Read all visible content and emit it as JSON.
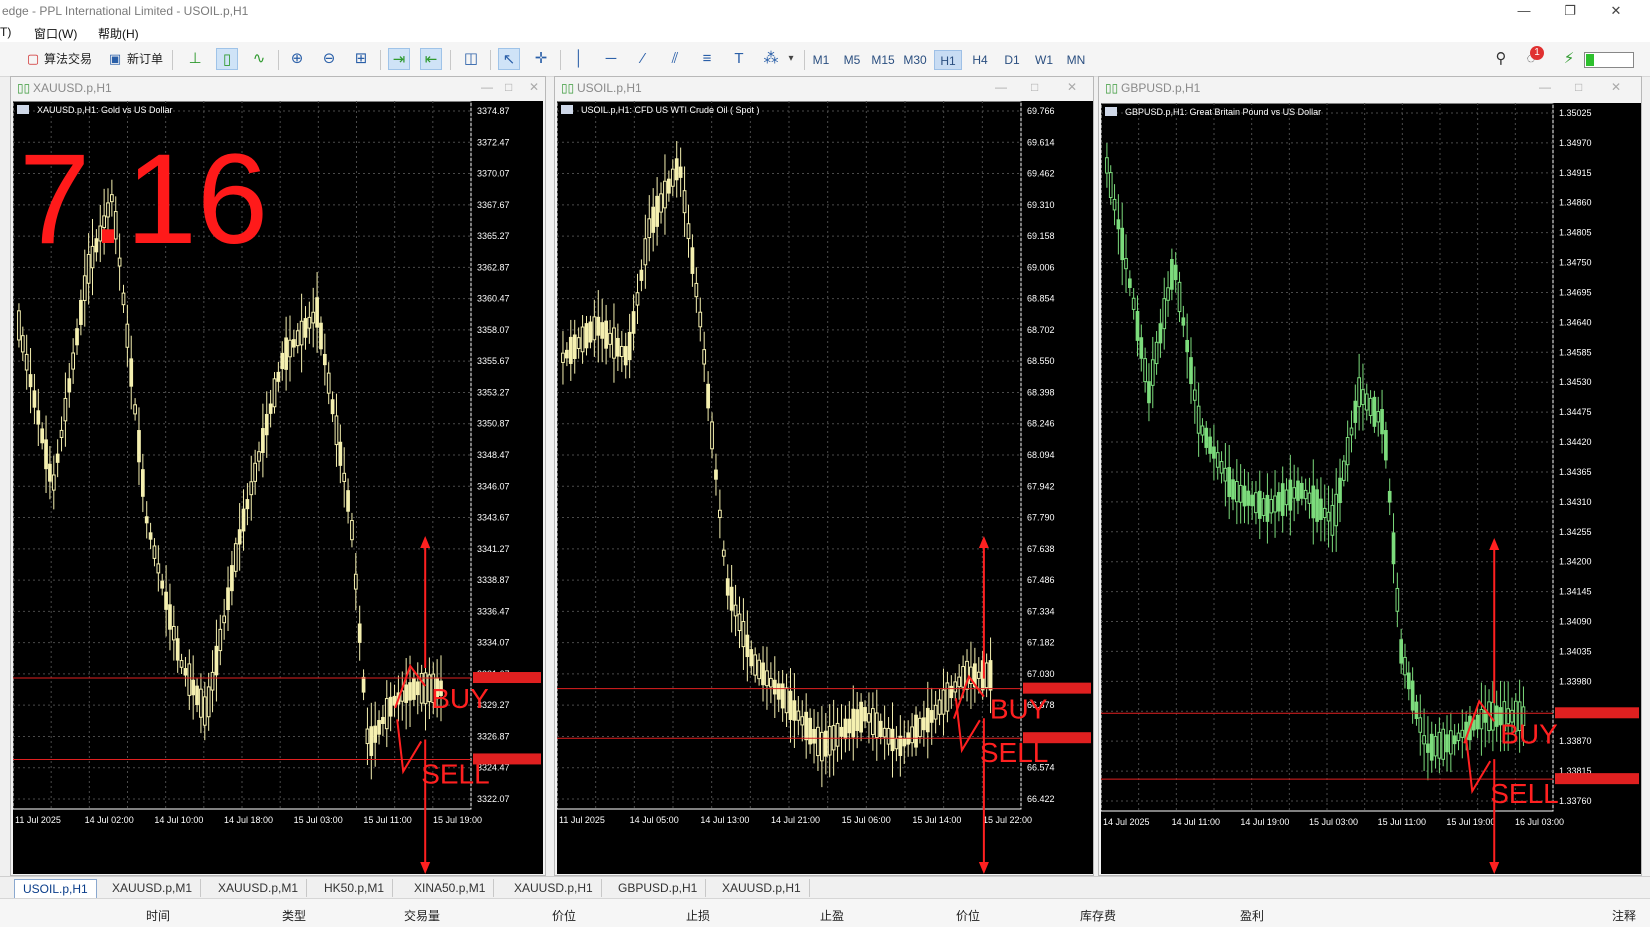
{
  "app_title": "edge - PPL International Limited - USOIL.p,H1",
  "window_buttons": [
    "—",
    "❐",
    "✕"
  ],
  "menu": [
    "T)",
    "窗口(W)",
    "帮助(H)"
  ],
  "toolbar": {
    "algo_label": "算法交易",
    "new_order_label": "新订单",
    "timeframes": [
      "M1",
      "M5",
      "M15",
      "M30",
      "H1",
      "H4",
      "D1",
      "W1",
      "MN"
    ],
    "active_timeframe": "H1",
    "notification_count": "1"
  },
  "windows": [
    {
      "title": "XAUUSD.p,H1",
      "header": "XAUUSD.p,H1:  Gold vs US Dollar",
      "candle_color": "#f5f0b0",
      "big_date": "7.16",
      "price_ticks": [
        "3374.87",
        "3372.47",
        "3370.07",
        "3367.67",
        "3365.27",
        "3362.87",
        "3360.47",
        "3358.07",
        "3355.67",
        "3353.27",
        "3350.87",
        "3348.47",
        "3346.07",
        "3343.67",
        "3341.27",
        "3338.87",
        "3336.47",
        "3334.07",
        "3331.67",
        "3329.27",
        "3326.87",
        "3324.47",
        "3322.07"
      ],
      "time_ticks": [
        "11 Jul 2025",
        "14 Jul 02:00",
        "14 Jul 10:00",
        "14 Jul 18:00",
        "15 Jul 03:00",
        "15 Jul 11:00",
        "15 Jul 19:00"
      ],
      "buy_label": "BUY",
      "sell_label": "SELL"
    },
    {
      "title": "USOIL.p,H1",
      "header": "USOIL.p,H1:  CFD US WTI Crude Oil ( Spot )",
      "candle_color": "#f5f0b0",
      "price_ticks": [
        "69.766",
        "69.614",
        "69.462",
        "69.310",
        "69.158",
        "69.006",
        "68.854",
        "68.702",
        "68.550",
        "68.398",
        "68.246",
        "68.094",
        "67.942",
        "67.790",
        "67.638",
        "67.486",
        "67.334",
        "67.182",
        "67.030",
        "66.878",
        "66.726",
        "66.574",
        "66.422"
      ],
      "time_ticks": [
        "11 Jul 2025",
        "14 Jul 05:00",
        "14 Jul 13:00",
        "14 Jul 21:00",
        "15 Jul 06:00",
        "15 Jul 14:00",
        "15 Jul 22:00"
      ],
      "buy_label": "BUY",
      "sell_label": "SELL"
    },
    {
      "title": "GBPUSD.p,H1",
      "header": "GBPUSD.p,H1:  Great Britain Pound vs US Dollar",
      "candle_color": "#7cdc7c",
      "price_ticks": [
        "1.35025",
        "1.34970",
        "1.34915",
        "1.34860",
        "1.34805",
        "1.34750",
        "1.34695",
        "1.34640",
        "1.34585",
        "1.34530",
        "1.34475",
        "1.34420",
        "1.34365",
        "1.34310",
        "1.34255",
        "1.34200",
        "1.34145",
        "1.34090",
        "1.34035",
        "1.33980",
        "1.33925",
        "1.33870",
        "1.33815",
        "1.33760"
      ],
      "time_ticks": [
        "14 Jul 2025",
        "14 Jul 11:00",
        "14 Jul 19:00",
        "15 Jul 03:00",
        "15 Jul 11:00",
        "15 Jul 19:00",
        "16 Jul 03:00"
      ],
      "buy_label": "BUY",
      "sell_label": "SELL"
    }
  ],
  "tabs": [
    "USOIL.p,H1",
    "XAUUSD.p,M1",
    "XAUUSD.p,M1",
    "HK50.p,M1",
    "XINA50.p,M1",
    "XAUUSD.p,H1",
    "GBPUSD.p,H1",
    "XAUUSD.p,H1"
  ],
  "active_tab": "USOIL.p,H1",
  "columns": [
    "时间",
    "类型",
    "交易量",
    "价位",
    "止损",
    "止盈",
    "价位",
    "库存费",
    "盈利",
    "注释"
  ]
}
